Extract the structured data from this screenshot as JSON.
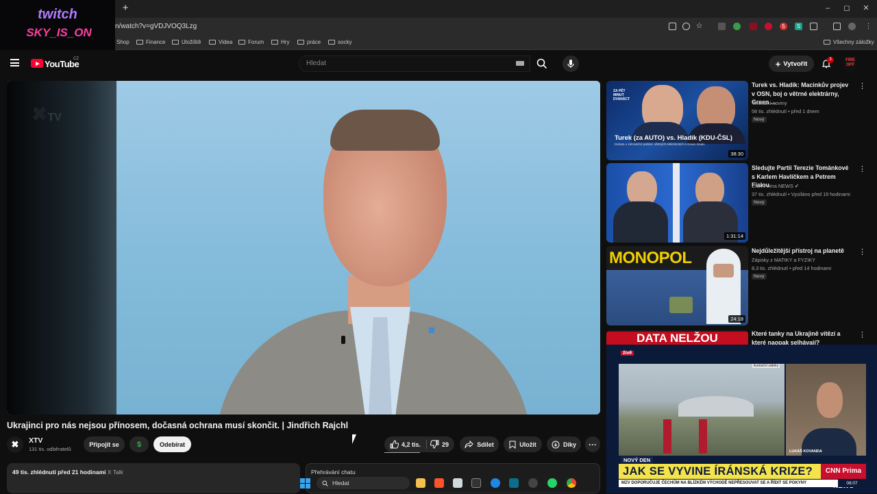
{
  "browser": {
    "url": "n/watch?v=gVDJVOQ3Lzg",
    "bookmarks": [
      "Shop",
      "Finance",
      "Uložiště",
      "Videa",
      "Forum",
      "Hry",
      "práce",
      "socky"
    ],
    "all_bookmarks_label": "Všechny záložky",
    "new_tab_label": "+",
    "minimize_label": "–",
    "maximize_label": "◻",
    "close_label": "✕"
  },
  "overlay": {
    "line1": "twitch",
    "line2": "SKY_IS_ON"
  },
  "youtube": {
    "logo_text": "YouTube",
    "logo_region": "CZ",
    "search_placeholder": "Hledat",
    "create_label": "Vytvořit",
    "notifications_count": "3",
    "avatar_text": "FIRE OFF"
  },
  "video": {
    "watermark": "TV",
    "title": "Ukrajinci pro nás nejsou přínosem, dočasná ochrana musí skončit. | Jindřich Rajchl",
    "channel_name": "XTV",
    "channel_avatar": "✖",
    "channel_subs": "131 tis. odběratelů",
    "join_label": "Připojit se",
    "dollar_label": "$",
    "unsubscribe_label": "Odebírat",
    "likes": "4,2 tis.",
    "dislikes": "29",
    "share_label": "Sdílet",
    "save_label": "Uložit",
    "thanks_label": "Díky",
    "more_label": "···",
    "description_stats": "49 tis. zhlédnutí  před 21 hodinami",
    "description_tag": "X Talk",
    "chat_replay_label": "Přehrávání chatu"
  },
  "sidebar": [
    {
      "title": "Turek vs. Hladík: Macinkův projev v OSN, boj o větrné elektrárny, Green ...",
      "channel": "Televizní noviny",
      "meta": "58 tis. zhlédnutí • před 1 dnem",
      "badge": "Nový",
      "duration": "38:30",
      "thumb_text": "Turek (za AUTO) vs. Hladík (KDU-ČSL)",
      "thumb_sub": "Debata o zahraniční politice, větrných elektrárnách a Green Dealu",
      "thumb_corner": "ZA PĚT MINUT DVANÁCT"
    },
    {
      "title": "Sledujte Partii Terezie Tománkové s Karlem Havlíčkem a Petrem Fialou",
      "channel": "CNN Prima NEWS ✔",
      "meta": "37 tis. zhlédnutí • Vysíláno před 19 hodinami",
      "badge": "Nový",
      "duration": "1:31:14"
    },
    {
      "title": "Nejdůležitější přístroj na planetě",
      "channel": "Zápisky z MATIKY a FYZIKY",
      "meta": "8,3 tis. zhlédnutí • před 14 hodinami",
      "badge": "Nový",
      "duration": "24:18",
      "thumb_text": "MONOPOL"
    },
    {
      "title": "Které tanky na Ukrajině vítězí a které naopak selhávají?",
      "thumb_text": "DATA NELŽOU"
    }
  ],
  "pip": {
    "live": "živě",
    "illustration": "ilustrační záběry",
    "guest_name": "LUKÁŠ KOVANDA",
    "new_day": "NOVÝ DEN",
    "headline": "JAK SE VYVINE ÍRÁNSKÁ KRIZE?",
    "logo": "CNN Prima NEWS",
    "ticker": "MZV DOPORUČUJE ČECHŮM NA BLÍZKÉM VÝCHODĚ NEPŘESOUVAT SE A ŘÍDIT SE POKYNY",
    "time": "08:07"
  },
  "taskbar": {
    "search_label": "Hledat"
  }
}
